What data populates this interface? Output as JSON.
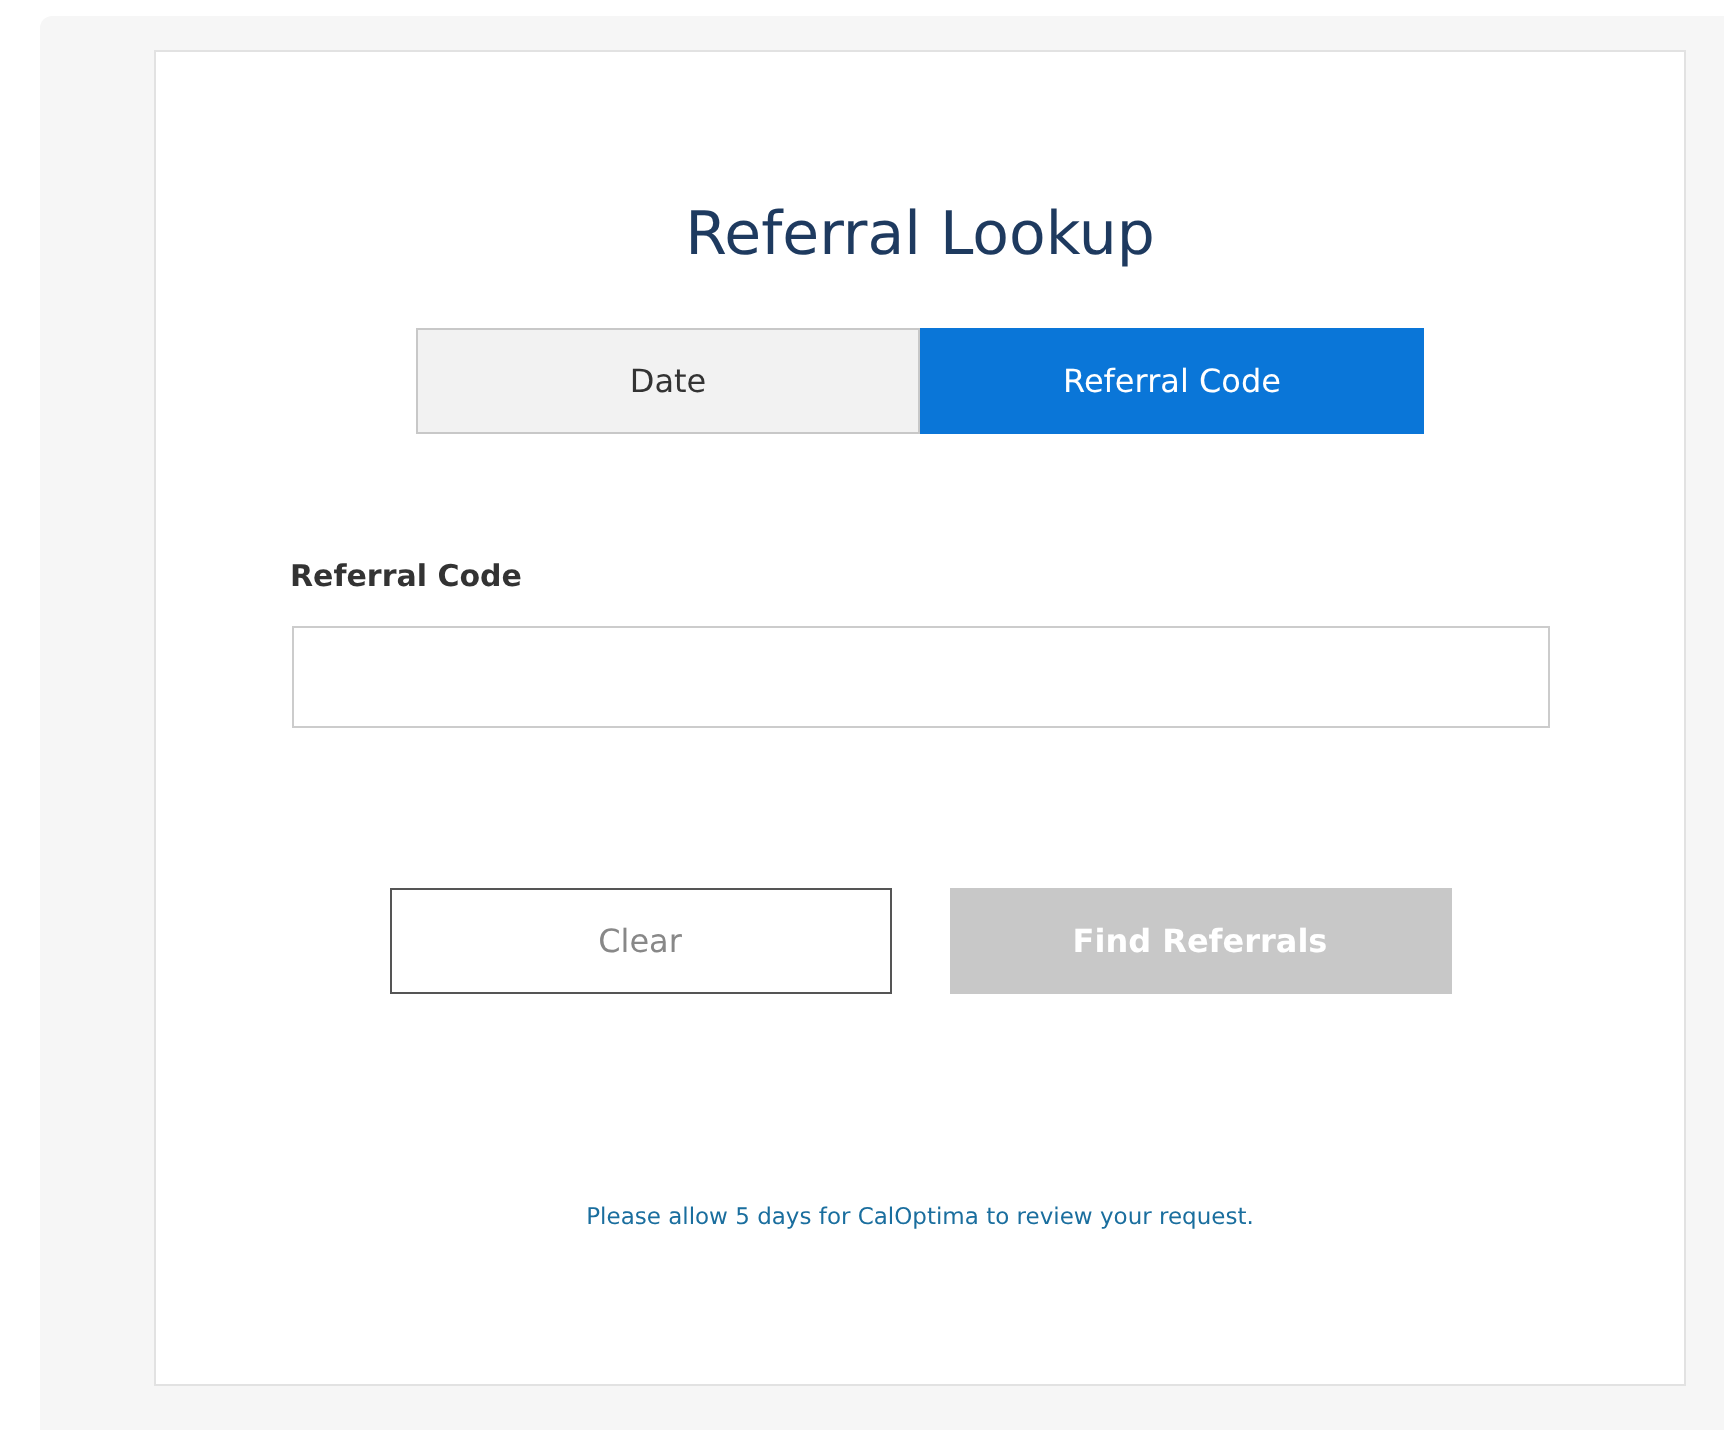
{
  "title": "Referral Lookup",
  "tabs": [
    {
      "label": "Date",
      "selected": false
    },
    {
      "label": "Referral Code",
      "selected": true
    }
  ],
  "field": {
    "label": "Referral Code"
  },
  "buttons": [
    {
      "label": "Clear",
      "kind": "outline",
      "disabled": false
    },
    {
      "label": "Find Referrals",
      "kind": "primary",
      "disabled": true
    }
  ],
  "note": "Please allow 5 days for CalOptima to review your request."
}
